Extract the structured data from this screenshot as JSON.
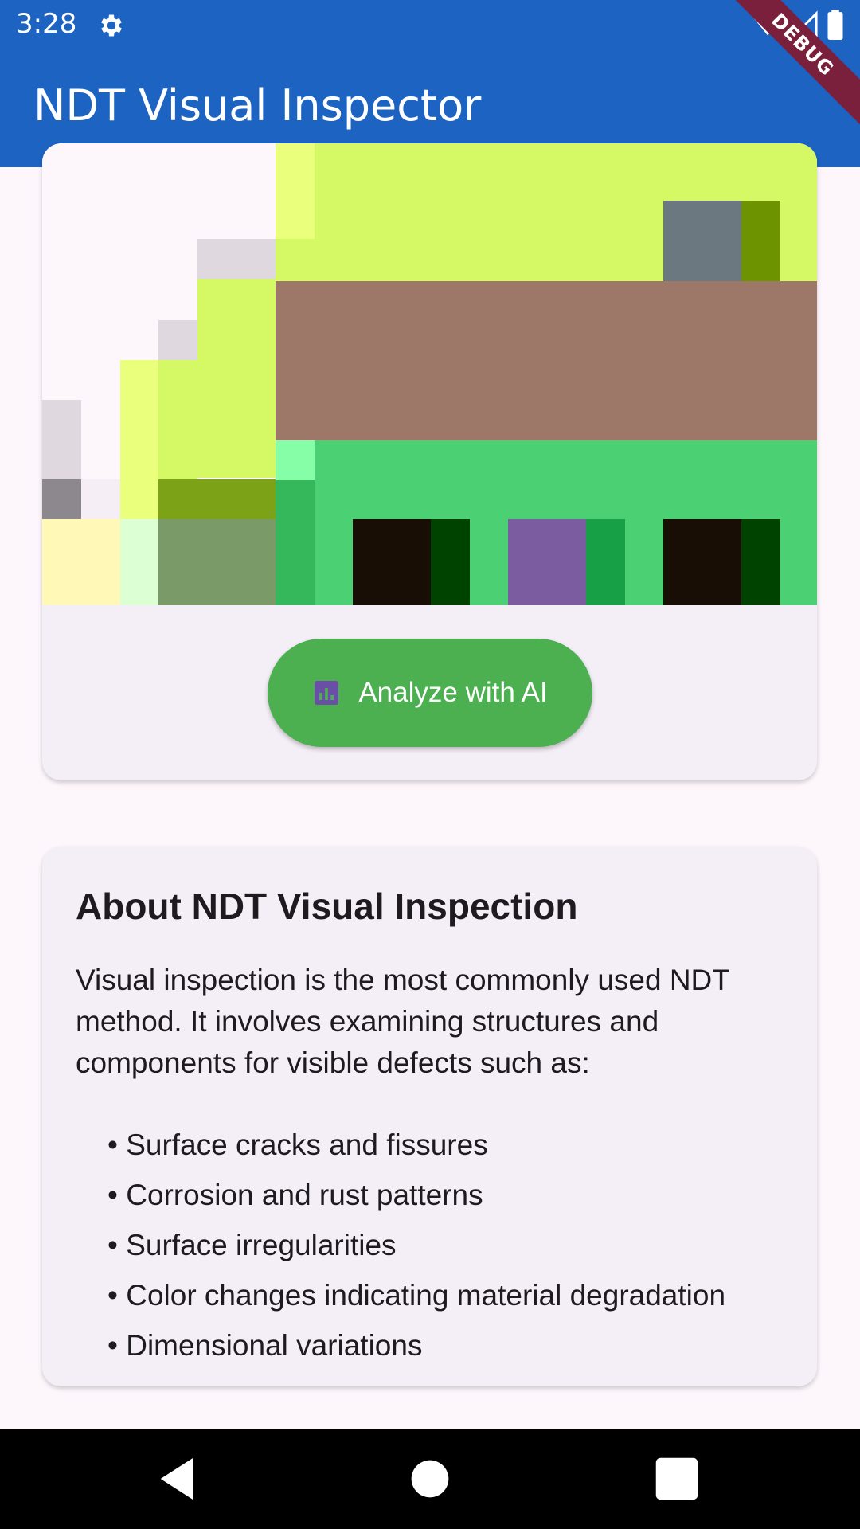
{
  "status_bar": {
    "time": "3:28",
    "settings_icon": "gear-icon",
    "wifi_icon": "wifi-icon",
    "signal_icon": "signal-icon",
    "battery_icon": "battery-icon"
  },
  "app_bar": {
    "title": "NDT Visual Inspector",
    "debug_banner": "DEBUG"
  },
  "image_card": {
    "analyze_button": {
      "label": "Analyze with AI",
      "icon": "analytics-icon"
    }
  },
  "about_card": {
    "title": "About NDT Visual Inspection",
    "description": "Visual inspection is the most commonly used NDT method. It involves examining structures and components for visible defects such as:",
    "bullets": [
      "Surface cracks and fissures",
      "Corrosion and rust patterns",
      "Surface irregularities",
      "Color changes indicating material degradation",
      "Dimensional variations"
    ]
  },
  "nav_bar": {
    "back_icon": "back-icon",
    "home_icon": "home-icon",
    "recents_icon": "recents-icon"
  },
  "colors": {
    "app_bar": "#1d63c2",
    "button": "#4caf50",
    "card": "#f4eff6",
    "background": "#fdf7fc"
  }
}
